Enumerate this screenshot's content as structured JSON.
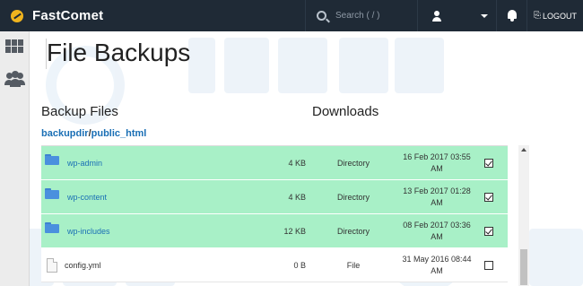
{
  "header": {
    "brand_name": "FastComet",
    "search_placeholder": "Search ( / )",
    "logout_label": "LOGOUT",
    "icons": [
      "fastcomet-logo-icon",
      "search-icon",
      "user-icon",
      "caret-down-icon",
      "bell-icon",
      "logout-icon"
    ]
  },
  "sidebar": {
    "icons": [
      "grid-icon",
      "users-icon"
    ]
  },
  "page": {
    "title": "File Backups"
  },
  "sections": {
    "backup_files": "Backup Files",
    "downloads": "Downloads"
  },
  "breadcrumb": {
    "dir": "backupdir",
    "sep": "/",
    "sub": "public_html"
  },
  "files": [
    {
      "name": "wp-admin",
      "size": "4 KB",
      "type": "Directory",
      "date": "16 Feb 2017 03:55 AM",
      "checked": true
    },
    {
      "name": "wp-content",
      "size": "4 KB",
      "type": "Directory",
      "date": "13 Feb 2017 01:28 AM",
      "checked": true
    },
    {
      "name": "wp-includes",
      "size": "12 KB",
      "type": "Directory",
      "date": "08 Feb 2017 03:36 AM",
      "checked": true
    },
    {
      "name": "config.yml",
      "size": "0 B",
      "type": "File",
      "date": "31 May 2016 08:44 AM",
      "checked": false
    }
  ],
  "colors": {
    "topbar": "#1f2a36",
    "selected_row": "#a8f0c7",
    "link": "#1a6fb5"
  }
}
